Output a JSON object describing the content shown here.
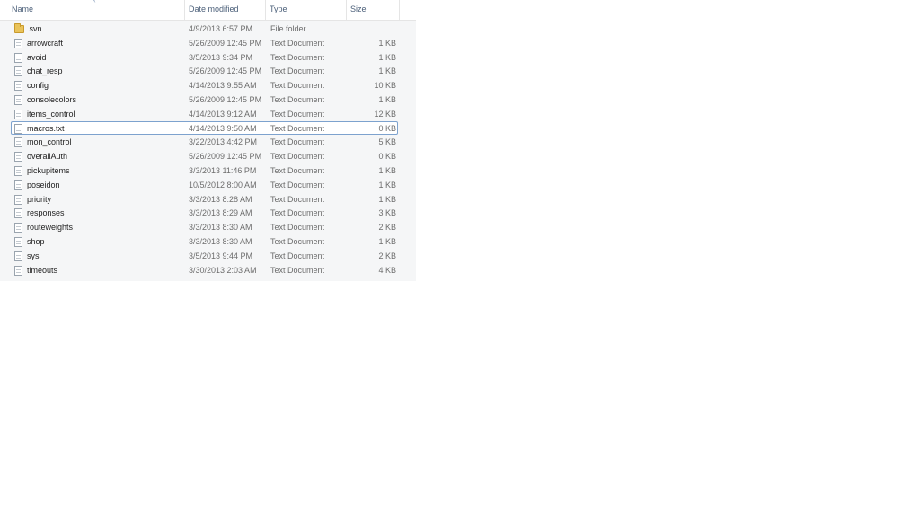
{
  "columns": {
    "name": "Name",
    "date_modified": "Date modified",
    "type": "Type",
    "size": "Size"
  },
  "sort": {
    "column": "Name",
    "indicator": "^"
  },
  "files": [
    {
      "name": ".svn",
      "date": "4/9/2013 6:57 PM",
      "type": "File folder",
      "size": "",
      "icon": "folder-icon"
    },
    {
      "name": "arrowcraft",
      "date": "5/26/2009 12:45 PM",
      "type": "Text Document",
      "size": "1 KB",
      "icon": "text-document-icon"
    },
    {
      "name": "avoid",
      "date": "3/5/2013 9:34 PM",
      "type": "Text Document",
      "size": "1 KB",
      "icon": "text-document-icon"
    },
    {
      "name": "chat_resp",
      "date": "5/26/2009 12:45 PM",
      "type": "Text Document",
      "size": "1 KB",
      "icon": "text-document-icon"
    },
    {
      "name": "config",
      "date": "4/14/2013 9:55 AM",
      "type": "Text Document",
      "size": "10 KB",
      "icon": "text-document-icon"
    },
    {
      "name": "consolecolors",
      "date": "5/26/2009 12:45 PM",
      "type": "Text Document",
      "size": "1 KB",
      "icon": "text-document-icon"
    },
    {
      "name": "items_control",
      "date": "4/14/2013 9:12 AM",
      "type": "Text Document",
      "size": "12 KB",
      "icon": "text-document-icon"
    },
    {
      "name": "macros.txt",
      "date": "4/14/2013 9:50 AM",
      "type": "Text Document",
      "size": "0 KB",
      "icon": "text-document-icon",
      "focused": true
    },
    {
      "name": "mon_control",
      "date": "3/22/2013 4:42 PM",
      "type": "Text Document",
      "size": "5 KB",
      "icon": "text-document-icon"
    },
    {
      "name": "overallAuth",
      "date": "5/26/2009 12:45 PM",
      "type": "Text Document",
      "size": "0 KB",
      "icon": "text-document-icon"
    },
    {
      "name": "pickupitems",
      "date": "3/3/2013 11:46 PM",
      "type": "Text Document",
      "size": "1 KB",
      "icon": "text-document-icon"
    },
    {
      "name": "poseidon",
      "date": "10/5/2012 8:00 AM",
      "type": "Text Document",
      "size": "1 KB",
      "icon": "text-document-icon"
    },
    {
      "name": "priority",
      "date": "3/3/2013 8:28 AM",
      "type": "Text Document",
      "size": "1 KB",
      "icon": "text-document-icon"
    },
    {
      "name": "responses",
      "date": "3/3/2013 8:29 AM",
      "type": "Text Document",
      "size": "3 KB",
      "icon": "text-document-icon"
    },
    {
      "name": "routeweights",
      "date": "3/3/2013 8:30 AM",
      "type": "Text Document",
      "size": "2 KB",
      "icon": "text-document-icon"
    },
    {
      "name": "shop",
      "date": "3/3/2013 8:30 AM",
      "type": "Text Document",
      "size": "1 KB",
      "icon": "text-document-icon"
    },
    {
      "name": "sys",
      "date": "3/5/2013 9:44 PM",
      "type": "Text Document",
      "size": "2 KB",
      "icon": "text-document-icon"
    },
    {
      "name": "timeouts",
      "date": "3/30/2013 2:03 AM",
      "type": "Text Document",
      "size": "4 KB",
      "icon": "text-document-icon"
    }
  ],
  "colors": {
    "header_text": "#4c607a",
    "focus_border": "#7da2ce",
    "folder": "#e9c35a"
  }
}
